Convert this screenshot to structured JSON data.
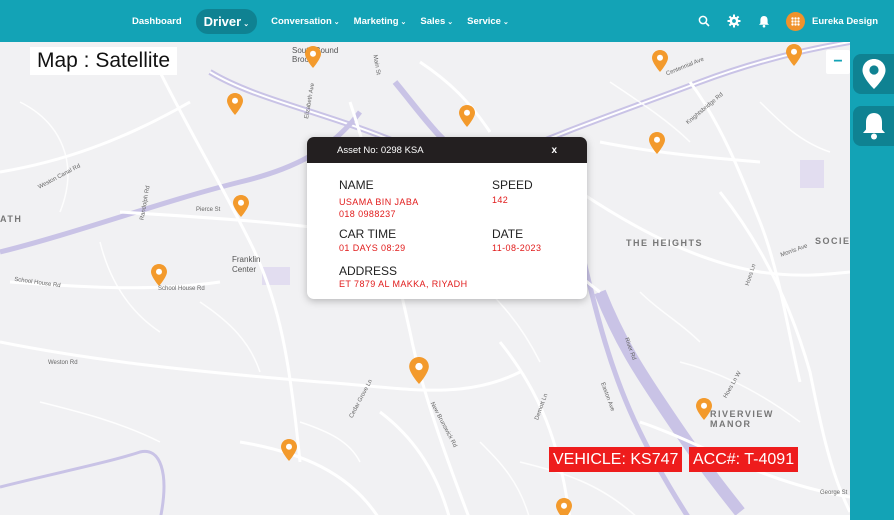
{
  "nav": {
    "items": [
      {
        "label": "Dashboard",
        "dropdown": false,
        "active": false
      },
      {
        "label": "Driver",
        "dropdown": true,
        "active": true
      },
      {
        "label": "Conversation",
        "dropdown": true,
        "active": false
      },
      {
        "label": "Marketing",
        "dropdown": true,
        "active": false
      },
      {
        "label": "Sales",
        "dropdown": true,
        "active": false
      },
      {
        "label": "Service",
        "dropdown": true,
        "active": false
      }
    ],
    "chevron": "⌄"
  },
  "header": {
    "icons": [
      "search-icon",
      "gear-icon",
      "bell-icon"
    ],
    "user_name": "Eureka Design"
  },
  "map": {
    "title": "Map : Satellite",
    "zoom_out": "−",
    "area_labels": {
      "heights": "THE HEIGHTS",
      "franklin": "Franklin\nCenter",
      "riverview": "RIVERVIEW\nMANOR",
      "societ": "SOCIET",
      "ath": "ATH",
      "southbound": "South Bound\nBrook"
    },
    "street_labels": {
      "westonCanal": "Weston Canal Rd",
      "pierce": "Pierce St",
      "schoolHouse": "School House Rd",
      "schoolHouse2": "School House Rd",
      "westonRd": "Weston Rd",
      "cedarGrove": "Cedar Grove Ln",
      "newBrunswick": "New Brunswick Rd",
      "demott": "Demott Ln",
      "eastonAve": "Easton Ave",
      "riverRd": "River Rd",
      "hoesLn": "Hoes Ln",
      "hoesLnW": "Hoes Ln W",
      "georgeSt": "George St",
      "centennial": "Centennial Ave",
      "elizabeth": "Elizabeth Ave",
      "morris": "Morris Ave",
      "knightsbridge": "Knightsbridge Rd",
      "randolph": "Randolph Rd",
      "main": "Main St"
    }
  },
  "popup": {
    "asset_no": "Asset No: 0298 KSA",
    "close": "x",
    "name_label": "NAME",
    "name_value": "USAMA BIN JABA",
    "phone_value": "018 0988237",
    "speed_label": "SPEED",
    "speed_value": "142",
    "car_time_label": "CAR TIME",
    "car_time_value": "01 DAYS 08:29",
    "date_label": "DATE",
    "date_value": "11-08-2023",
    "address_label": "ADDRESS",
    "address_value": "ET 7879 AL MAKKA, RIYADH"
  },
  "badges": {
    "vehicle": "VEHICLE: KS747",
    "acc": "ACC#: T-4091"
  },
  "colors": {
    "brand": "#13a3b6",
    "brand_dark": "#0f8292",
    "pin": "#f39a2c",
    "alert_red": "#ee1c1c"
  }
}
